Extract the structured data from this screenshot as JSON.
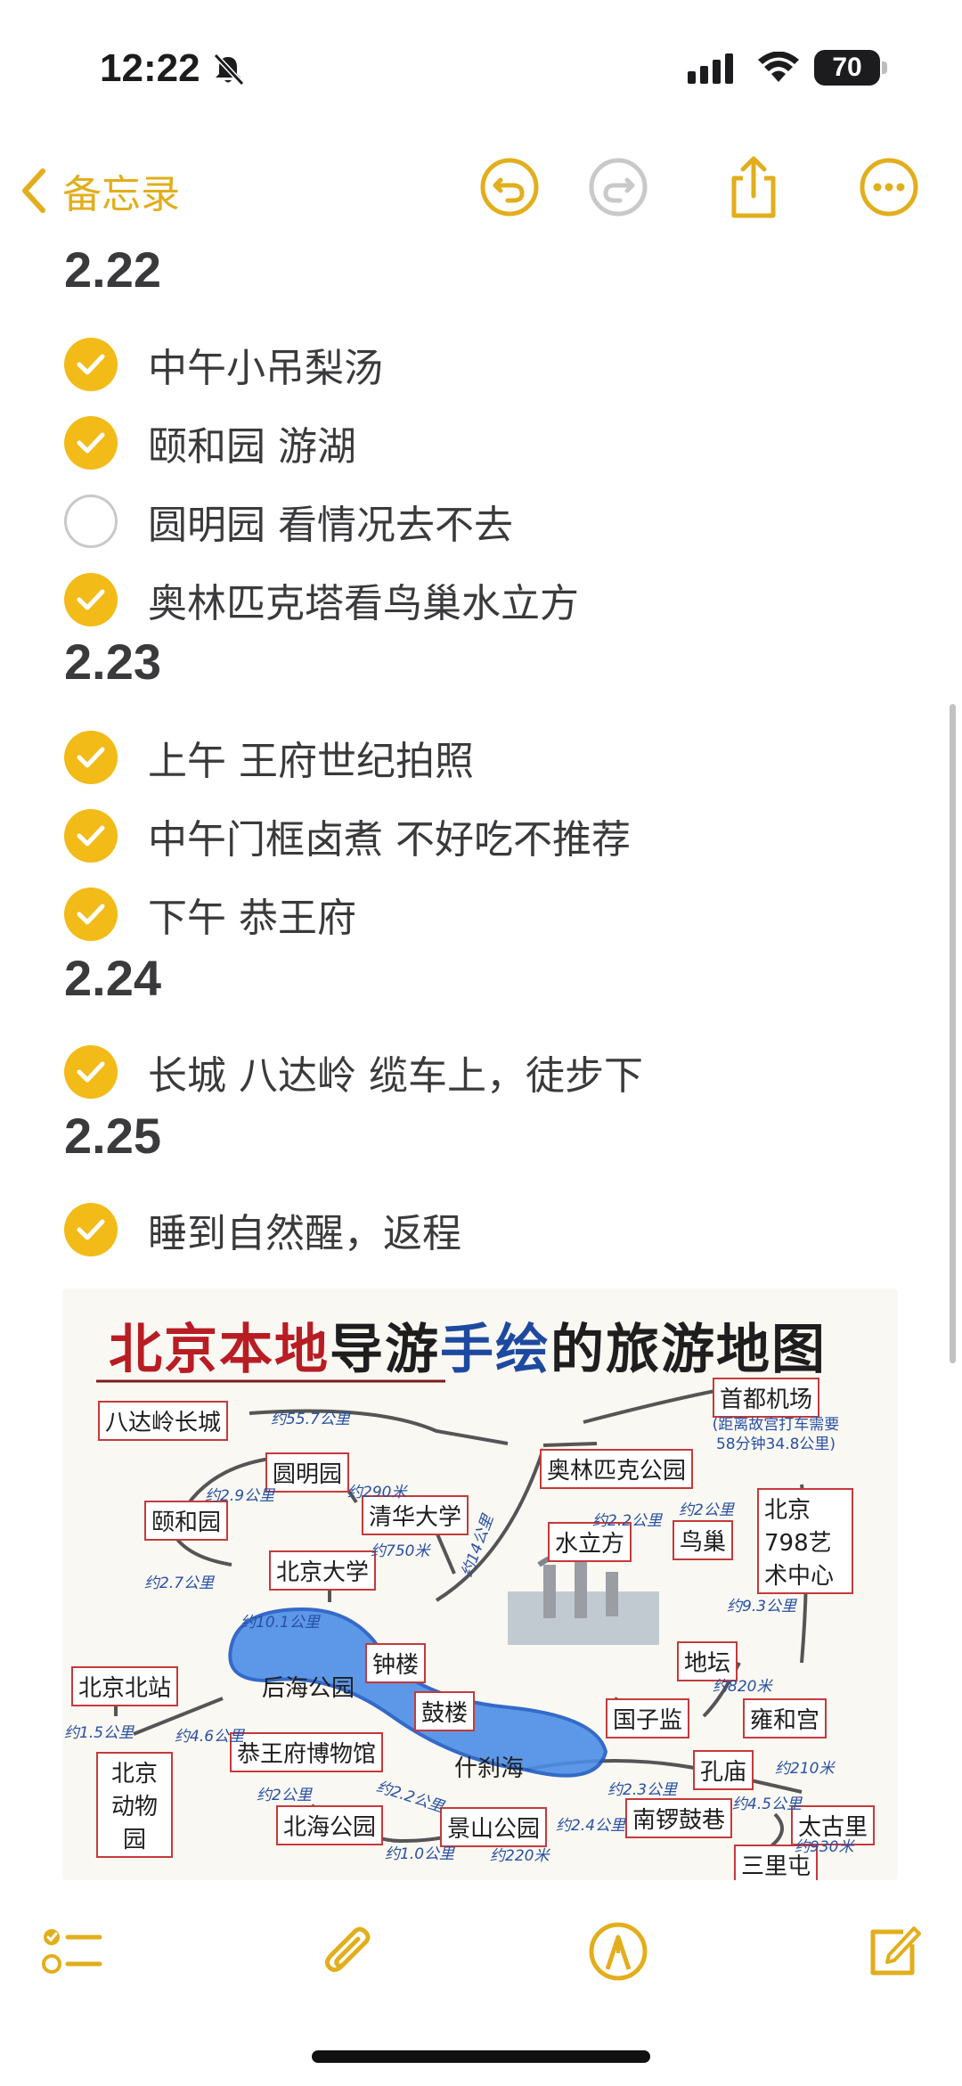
{
  "status": {
    "time": "12:22",
    "battery": "70"
  },
  "nav": {
    "back_label": "备忘录"
  },
  "note": {
    "sections": [
      {
        "date": "2.22",
        "items": [
          {
            "text": "中午小吊梨汤",
            "checked": true
          },
          {
            "text": "颐和园 游湖",
            "checked": true
          },
          {
            "text": "圆明园 看情况去不去",
            "checked": false
          },
          {
            "text": "奥林匹克塔看鸟巢水立方",
            "checked": true
          }
        ]
      },
      {
        "date": "2.23",
        "items": [
          {
            "text": "上午 王府世纪拍照",
            "checked": true
          },
          {
            "text": "中午门框卤煮 不好吃不推荐",
            "checked": true
          },
          {
            "text": "下午 恭王府",
            "checked": true
          }
        ]
      },
      {
        "date": "2.24",
        "items": [
          {
            "text": "长城 八达岭 缆车上，徒步下",
            "checked": true
          }
        ]
      },
      {
        "date": "2.25",
        "items": [
          {
            "text": "睡到自然醒，返程",
            "checked": true
          }
        ]
      }
    ]
  },
  "map": {
    "title_part1": "北京本地",
    "title_part2": "导游",
    "title_part3": "手绘",
    "title_part4": "的旅游地图",
    "places": {
      "badaling": "八达岭长城",
      "airport": "首都机场",
      "airport_note": "(距离故宫打车需要58分钟34.8公里)",
      "yuanmingyuan": "圆明园",
      "olympic": "奥林匹克公园",
      "summer_palace": "颐和园",
      "tsinghua": "清华大学",
      "art798": "北京798艺术中心",
      "water_cube": "水立方",
      "birds_nest": "鸟巢",
      "pku": "北京大学",
      "north_station": "北京北站",
      "houhai": "后海公园",
      "bell_tower": "钟楼",
      "drum_tower": "鼓楼",
      "ditan": "地坛",
      "guozijian": "国子监",
      "yonghegong": "雍和宫",
      "zoo": "北京动物园",
      "prince_gong": "恭王府博物馆",
      "shichahai": "什刹海",
      "confucius": "孔庙",
      "beihai": "北海公园",
      "jingshan": "景山公园",
      "nanluoguxiang": "南锣鼓巷",
      "taikoo": "太古里",
      "sanlitun": "三里屯"
    },
    "distances": {
      "d1": "约55.7公里",
      "d2": "约2.9公里",
      "d3": "约290米",
      "d4": "约750米",
      "d5": "约2.7公里",
      "d6": "约10.1公里",
      "d7": "约14公里",
      "d8": "约2.2公里",
      "d9": "约2公里",
      "d10": "约9.3公里",
      "d11": "约820米",
      "d12": "约1.5公里",
      "d13": "约4.6公里",
      "d14": "约2公里",
      "d15": "约2.2公里",
      "d16": "约1.0公里",
      "d17": "约220米",
      "d18": "约2.4公里",
      "d19": "约2.3公里",
      "d20": "约4.5公里",
      "d21": "约210米",
      "d22": "约930米"
    }
  },
  "icons": {
    "accent": "#f2bb18",
    "nav_tint": "#e2ae1b"
  }
}
